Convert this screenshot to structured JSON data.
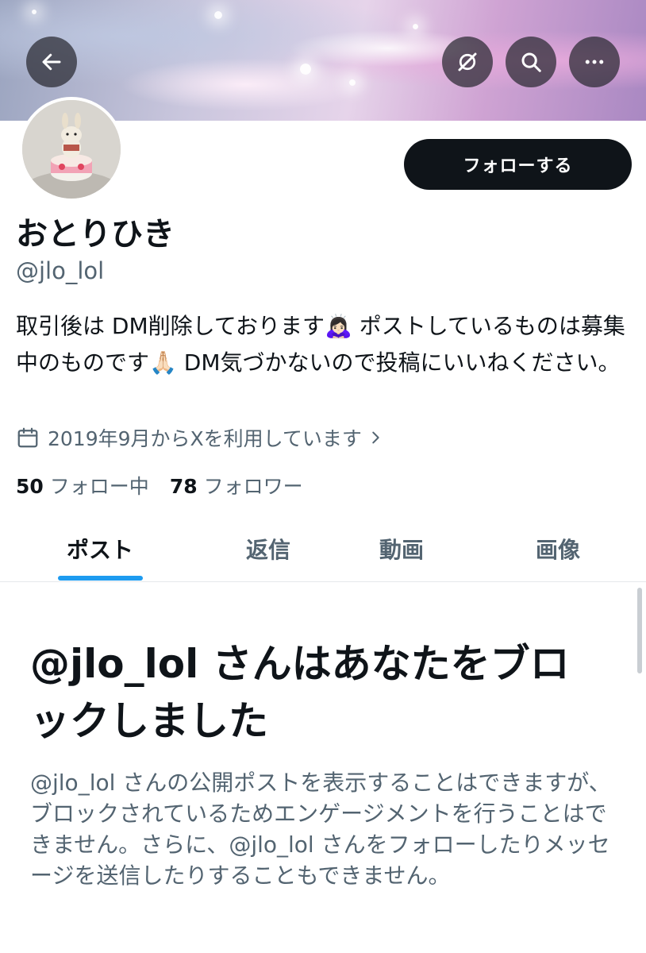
{
  "header": {
    "back_icon": "arrow-left-icon",
    "grok_icon": "grok-slash-icon",
    "search_icon": "search-icon",
    "more_icon": "more-horizontal-icon"
  },
  "profile": {
    "name": "おとりひき",
    "handle": "@jlo_lol",
    "follow_label": "フォローする",
    "bio_1": "取引後は DM削除しております",
    "bio_emoji_1": "🙇🏻‍♀️",
    "bio_2": " ポストしているものは募集中のものです",
    "bio_emoji_2": "🙏🏻",
    "bio_3": " DM気づかないので投稿にいいねください。",
    "joined": "2019年9月からXを利用しています",
    "following_count": "50",
    "following_label": "フォロー中",
    "followers_count": "78",
    "followers_label": "フォロワー"
  },
  "tabs": [
    {
      "label": "ポスト"
    },
    {
      "label": "返信"
    },
    {
      "label": "動画"
    },
    {
      "label": "画像"
    }
  ],
  "blocked": {
    "title": "@jlo_lol さんはあなたをブロックしました",
    "message": "@jlo_lol さんの公開ポストを表示することはできますが、ブロックされているためエンゲージメントを行うことはできません。さらに、@jlo_lol さんをフォローしたりメッセージを送信したりすることもできません。"
  },
  "colors": {
    "accent": "#1d9bf0",
    "text_primary": "#0f1419",
    "text_secondary": "#536471",
    "follow_button": "#0f1419"
  }
}
